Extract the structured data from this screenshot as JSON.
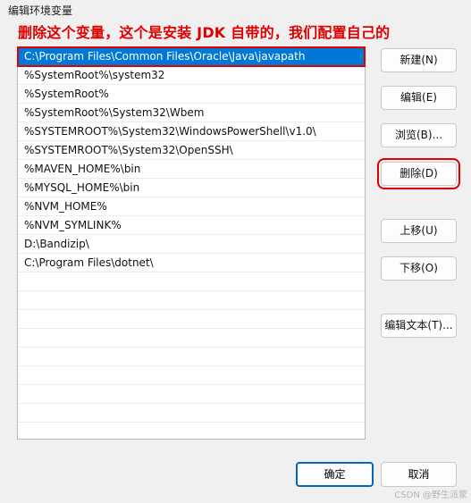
{
  "window": {
    "title": "编辑环境变量"
  },
  "annotation": {
    "text": "删除这个变量，这个是安装 JDK 自带的，我们配置自己的",
    "color": "#e00000"
  },
  "path_list": {
    "items": [
      {
        "value": "C:\\Program Files\\Common Files\\Oracle\\Java\\javapath",
        "selected": true
      },
      {
        "value": "%SystemRoot%\\system32"
      },
      {
        "value": "%SystemRoot%"
      },
      {
        "value": "%SystemRoot%\\System32\\Wbem"
      },
      {
        "value": "%SYSTEMROOT%\\System32\\WindowsPowerShell\\v1.0\\"
      },
      {
        "value": "%SYSTEMROOT%\\System32\\OpenSSH\\"
      },
      {
        "value": "%MAVEN_HOME%\\bin"
      },
      {
        "value": "%MYSQL_HOME%\\bin"
      },
      {
        "value": "%NVM_HOME%"
      },
      {
        "value": "%NVM_SYMLINK%"
      },
      {
        "value": "D:\\Bandizip\\"
      },
      {
        "value": "C:\\Program Files\\dotnet\\"
      },
      {
        "value": ""
      },
      {
        "value": ""
      },
      {
        "value": ""
      },
      {
        "value": ""
      },
      {
        "value": ""
      },
      {
        "value": ""
      },
      {
        "value": ""
      },
      {
        "value": ""
      }
    ]
  },
  "buttons": {
    "new": "新建(N)",
    "edit": "编辑(E)",
    "browse": "浏览(B)...",
    "delete": "删除(D)",
    "move_up": "上移(U)",
    "move_down": "下移(O)",
    "edit_text": "编辑文本(T)...",
    "ok": "确定",
    "cancel": "取消"
  },
  "watermark": "CSDN @野生派蒙",
  "colors": {
    "selection": "#0078d7",
    "highlight_red": "#e00000",
    "accent": "#0067c0"
  }
}
